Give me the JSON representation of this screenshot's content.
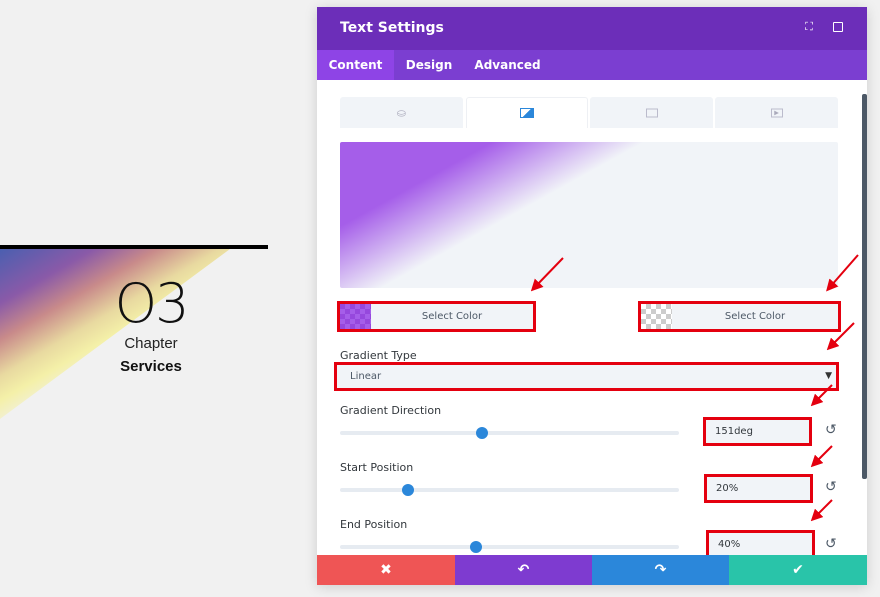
{
  "page": {
    "number": "O3",
    "chapter": "Chapter",
    "title": "Services"
  },
  "panel": {
    "title": "Text Settings",
    "header_icons": [
      "fullscreen-icon",
      "split-view-icon"
    ],
    "tabs": [
      {
        "label": "Content",
        "active": true
      },
      {
        "label": "Design",
        "active": false
      },
      {
        "label": "Advanced",
        "active": false
      }
    ],
    "background_tabs": [
      {
        "icon": "paint-bucket-icon"
      },
      {
        "icon": "gradient-icon",
        "active": true
      },
      {
        "icon": "image-icon"
      },
      {
        "icon": "video-icon"
      }
    ],
    "gradient_preview": {
      "start_color": "#a55ee9",
      "end_color": "transparent",
      "direction_deg": 151,
      "start": 20,
      "end": 40
    },
    "color_pickers": [
      {
        "label": "Select Color",
        "swatch": "#a55ee9"
      },
      {
        "label": "Select Color",
        "swatch": "transparent"
      }
    ],
    "gradient_type": {
      "label": "Gradient Type",
      "value": "Linear"
    },
    "gradient_direction": {
      "label": "Gradient Direction",
      "value": "151deg",
      "fraction": 0.42
    },
    "start_position": {
      "label": "Start Position",
      "value": "20%",
      "fraction": 0.2
    },
    "end_position": {
      "label": "End Position",
      "value": "40%",
      "fraction": 0.4
    },
    "footer": [
      {
        "action": "cancel",
        "icon": "✖",
        "color": "#ef5555"
      },
      {
        "action": "undo",
        "icon": "↶",
        "color": "#7e3bd0"
      },
      {
        "action": "redo",
        "icon": "↷",
        "color": "#2b87da"
      },
      {
        "action": "save",
        "icon": "✔",
        "color": "#29c4a9"
      }
    ],
    "colors": {
      "header": "#6c2eb9",
      "tabs": "#7b3ed1",
      "active_tab": "#8e44e6",
      "highlight": "#e4000f"
    }
  }
}
